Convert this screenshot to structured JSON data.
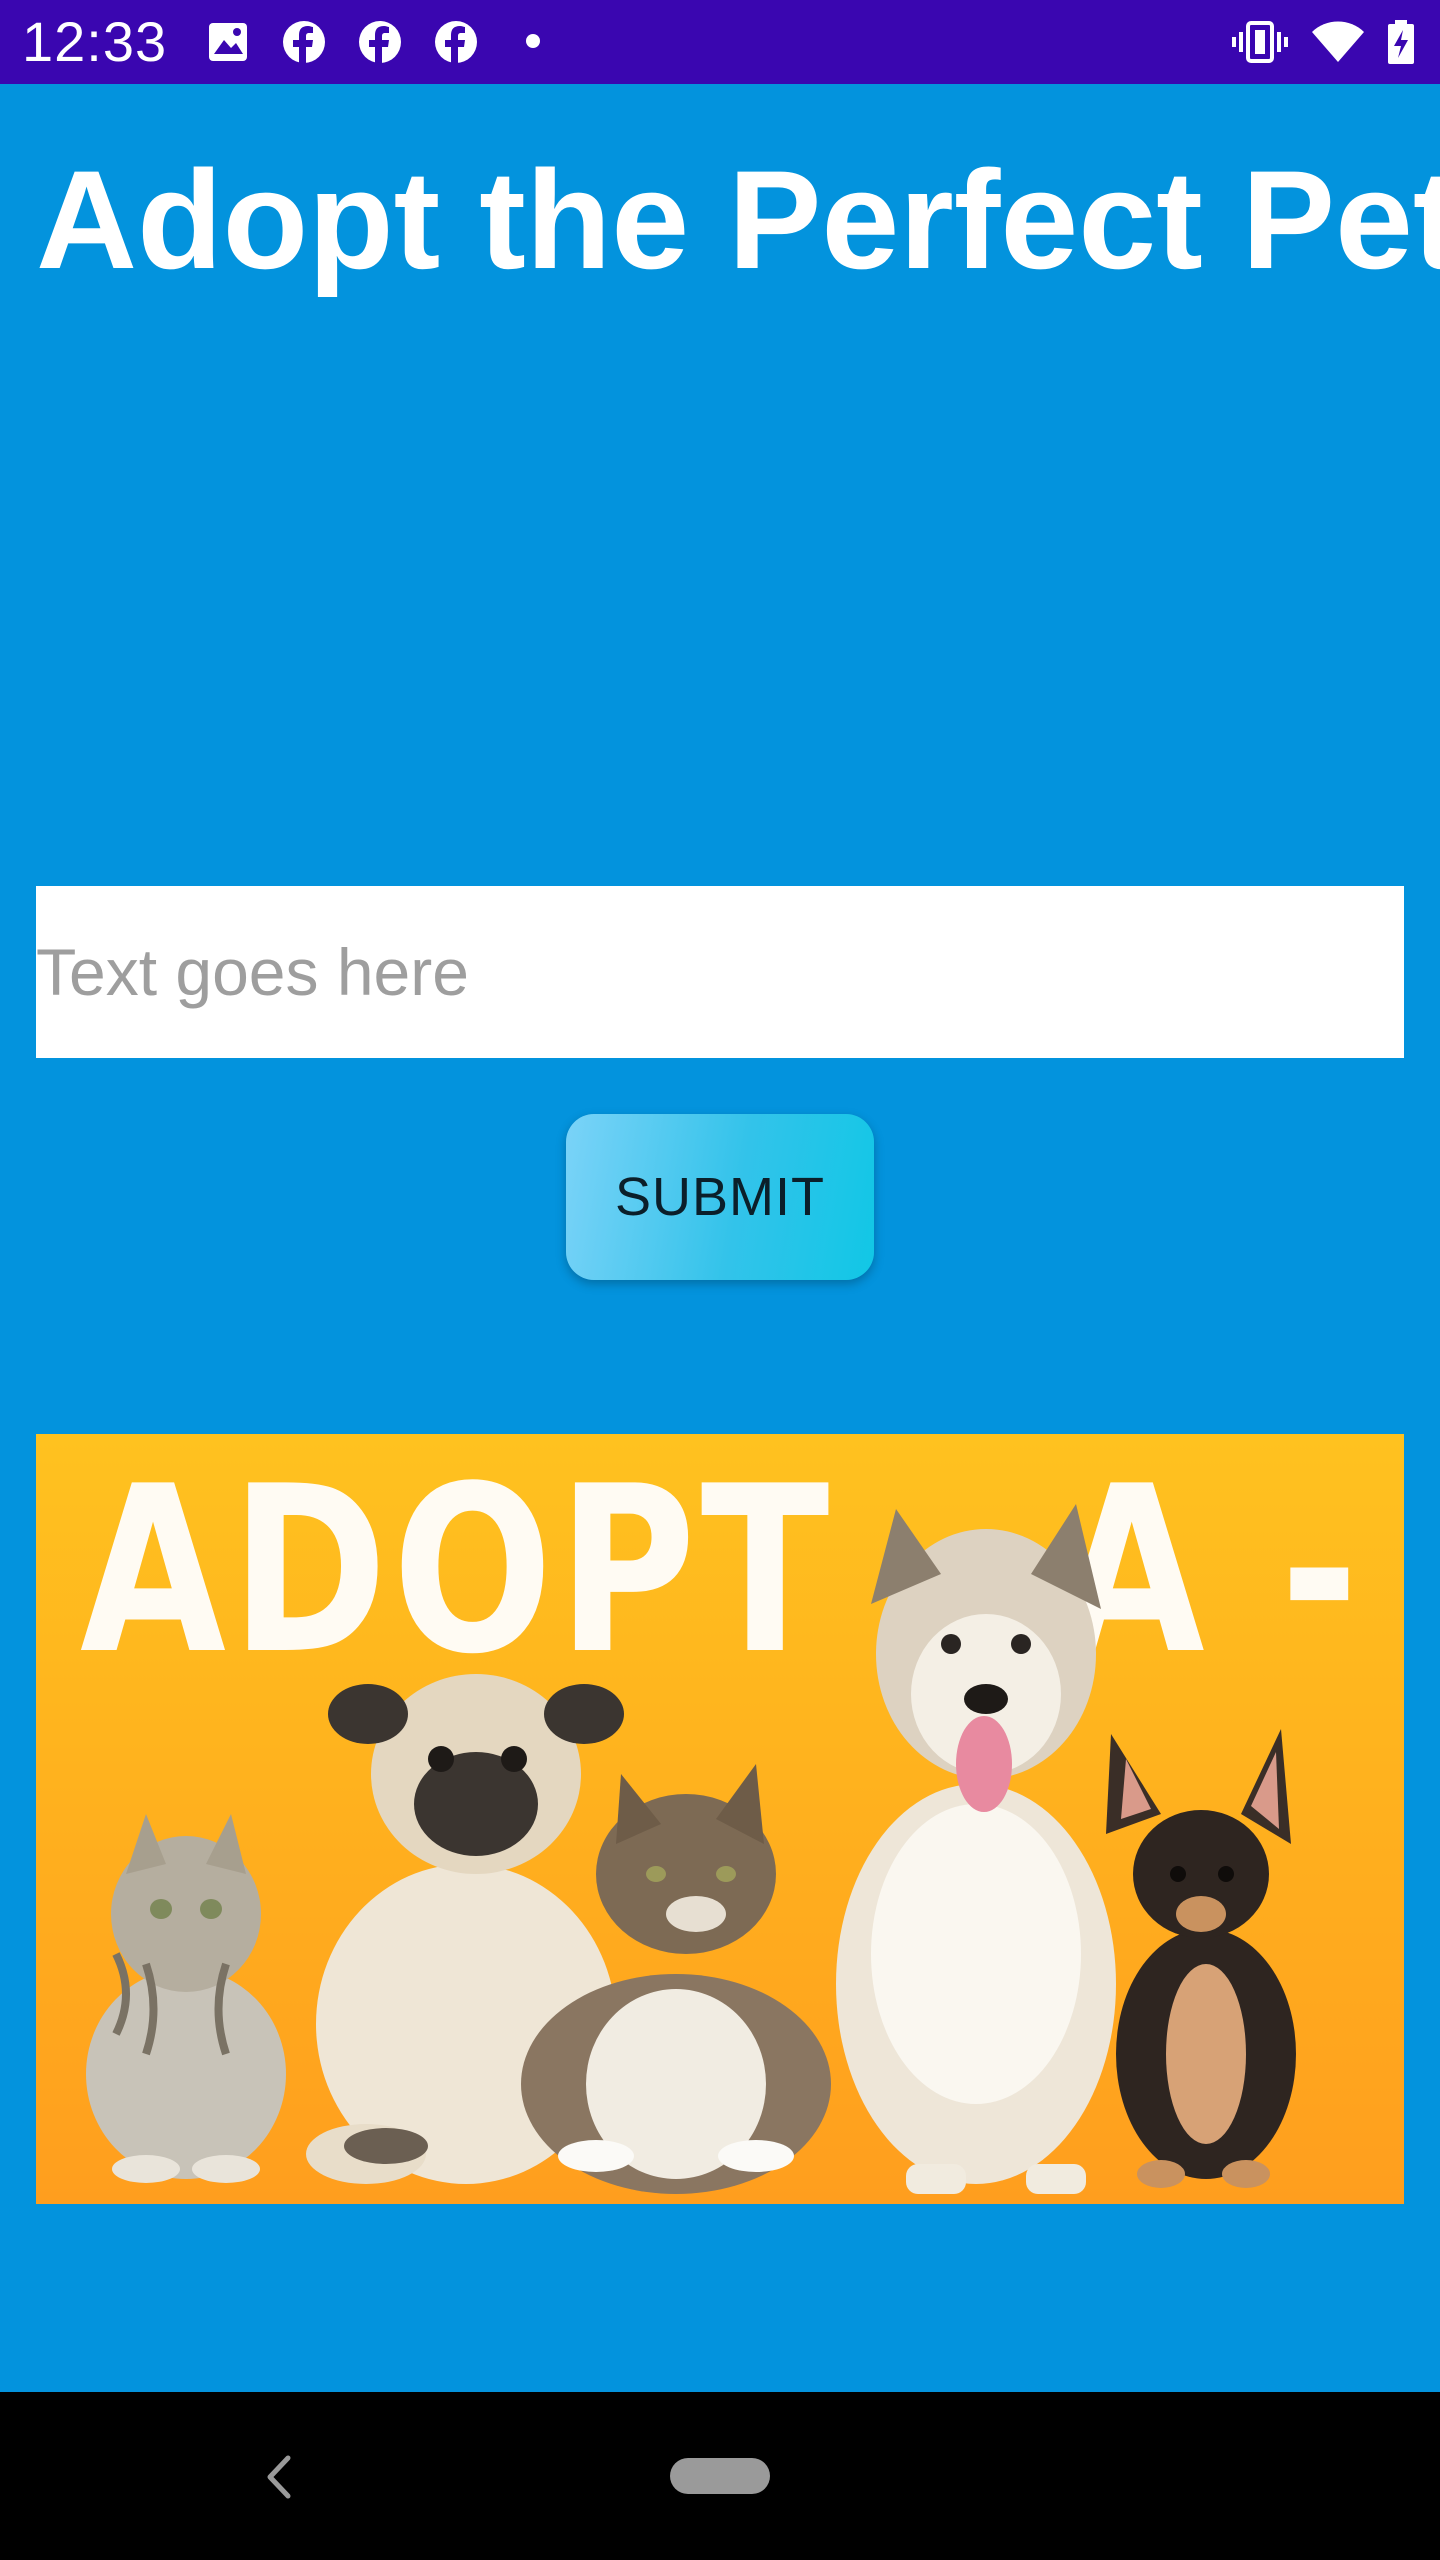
{
  "status_bar": {
    "time": "12:33",
    "left_icons": [
      "image-icon",
      "facebook-icon",
      "facebook-icon",
      "facebook-icon",
      "dot-icon"
    ],
    "right_icons": [
      "vibrate-icon",
      "wifi-icon",
      "battery-charging-icon"
    ],
    "background": "#3A06B0"
  },
  "page": {
    "title": "Adopt the Perfect Pet",
    "background": "#0393DD"
  },
  "form": {
    "input_placeholder": "Text goes here",
    "input_value": "",
    "submit_label": "SUBMIT"
  },
  "banner": {
    "text": "ADOPT - A - PET",
    "animals": [
      "kitten",
      "pug",
      "maine-coon-cat",
      "husky-dog",
      "chihuahua"
    ],
    "background": "#FFB01E"
  },
  "nav_bar": {
    "icons": [
      "back-icon",
      "home-icon"
    ]
  }
}
